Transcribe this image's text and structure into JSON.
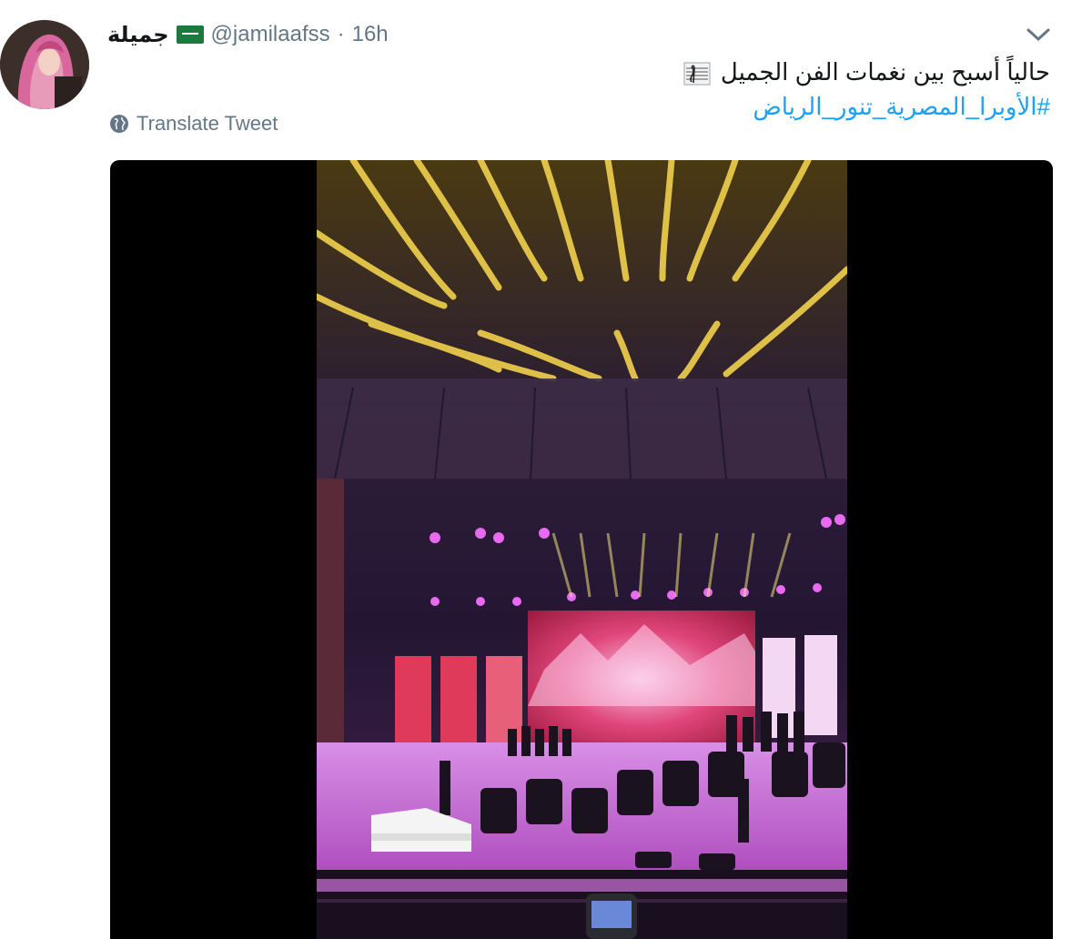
{
  "author": {
    "display_name": "جميلة",
    "handle": "@jamilaafss",
    "separator": "·",
    "time": "16h"
  },
  "tweet": {
    "text_prefix": "حالياً أسبح بين نغمات الفن الجميل",
    "hashtag": "#الأوبرا_المصرية_تنور_الرياض"
  },
  "actions": {
    "translate_label": "Translate Tweet"
  },
  "icons": {
    "flag": "saudi-flag-icon",
    "music": "musical-score-icon",
    "chevron": "chevron-down-icon",
    "globe": "globe-icon"
  },
  "colors": {
    "text": "#14171a",
    "muted": "#657786",
    "link": "#1da1f2"
  }
}
